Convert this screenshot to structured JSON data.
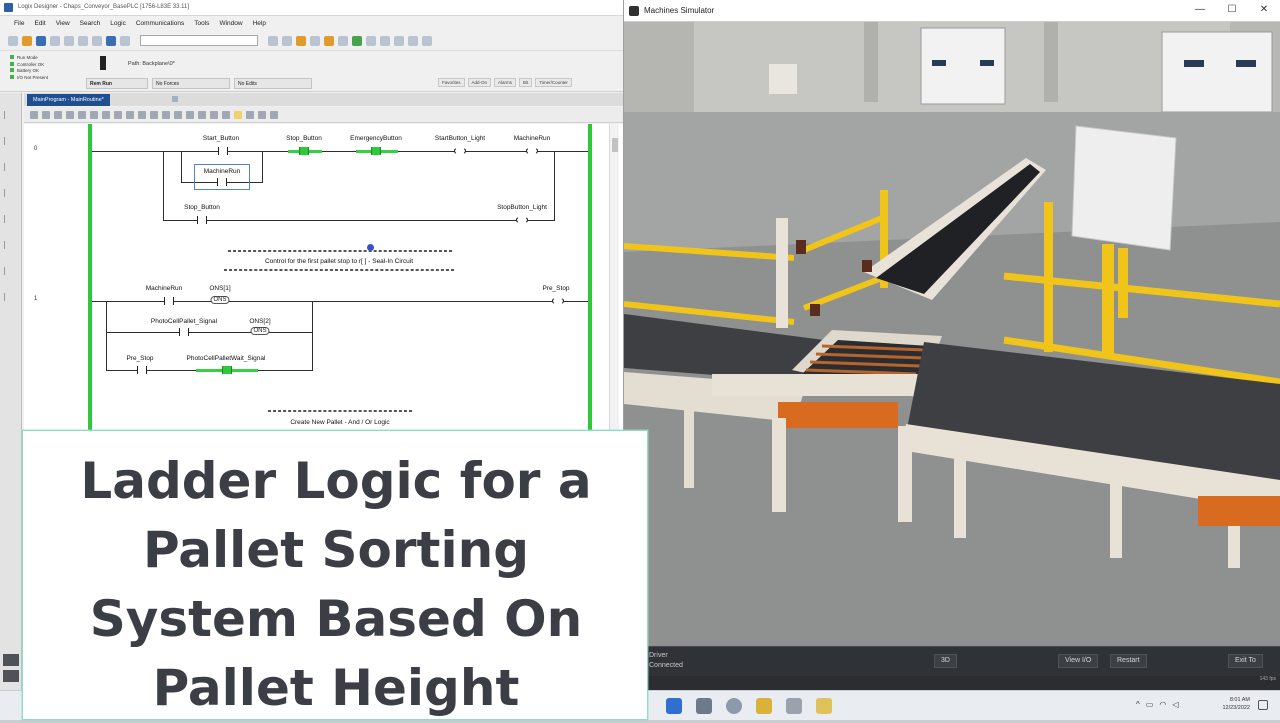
{
  "logix": {
    "title": "Logix Designer - Chaps_Conveyor_BasePLC [1756-L83E 33.11]",
    "menu": [
      "File",
      "Edit",
      "View",
      "Search",
      "Logic",
      "Communications",
      "Tools",
      "Window",
      "Help"
    ],
    "status_lines": [
      "Run Mode",
      "Controller OK",
      "Battery OK",
      "I/O Not Present"
    ],
    "mode_box": "Rem Run",
    "forces_box": "No Forces",
    "edits_box": "No Edits",
    "path_label": "Path: Backplane\\0*",
    "quick_tabs": [
      "Favorites",
      "Add-On",
      "Alarms",
      "Bit",
      "Timer/Counter"
    ],
    "routine_tab": "MainProgram - MainRoutine*",
    "rungs": {
      "rung0_num": "0",
      "rung1_num": "1",
      "start_button": "Start_Button",
      "stop_button": "Stop_Button",
      "emergency_button": "EmergencyButton",
      "start_button_light": "StartButton_Light",
      "machine_run_coil": "MachineRun",
      "machine_run_seal": "MachineRun",
      "stop_button_branch": "Stop_Button",
      "stop_button_light": "StopButton_Light",
      "comment1": "Control for the first pallet stop to r[ ] - Seal-In Circuit",
      "machine_run_r1": "MachineRun",
      "ons1": "ONS[1]",
      "ons_label": "ONS",
      "pre_stop_coil": "Pre_Stop",
      "photocell_pallet": "PhotoCellPallet_Signal",
      "ons2": "ONS[2]",
      "pre_stop_contact": "Pre_Stop",
      "photocell_wait": "PhotoCellPalletWait_Signal",
      "comment2": "Create New Pallet - And / Or Logic"
    }
  },
  "simulator": {
    "title": "Machines Simulator",
    "window_buttons": [
      "—",
      "☐",
      "✕"
    ],
    "driver_label": "Driver",
    "driver_status": "Connected",
    "btn_3d": "3D",
    "btn_view_io": "View I/O",
    "btn_restart": "Restart",
    "btn_exit": "Exit To",
    "fps": "143 fps"
  },
  "taskbar": {
    "tray_chevron": "^",
    "time": "8:01 AM",
    "date": "12/23/2022"
  },
  "overlay": {
    "lines": [
      "Ladder Logic for a",
      "Pallet Sorting",
      "System Based On",
      "Pallet Height"
    ]
  },
  "colors": {
    "rail_green": "#2ec83a",
    "energized_green": "#35d043",
    "routine_tab_blue": "#1f4e91",
    "safety_yellow": "#f0c419",
    "overlay_text": "#3b3f45",
    "overlay_border": "#8fdcc8"
  }
}
